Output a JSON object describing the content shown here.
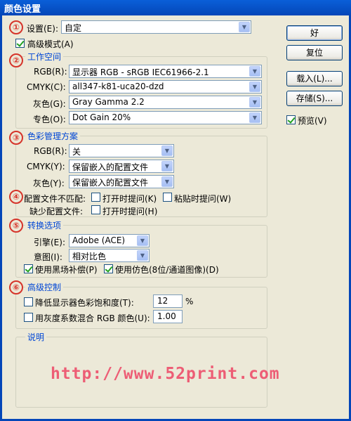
{
  "window": {
    "title": "颜色设置"
  },
  "markers": [
    "①",
    "②",
    "③",
    "④",
    "⑤",
    "⑥"
  ],
  "settings": {
    "label": "设置(E):",
    "value": "自定"
  },
  "advanced_mode": {
    "label": "高级模式(A)",
    "checked": true
  },
  "working_spaces": {
    "title": "工作空间",
    "rows": [
      {
        "label": "RGB(R):",
        "value": "显示器 RGB - sRGB IEC61966-2.1"
      },
      {
        "label": "CMYK(C):",
        "value": "all347-k81-uca20-dzd"
      },
      {
        "label": "灰色(G):",
        "value": "Gray Gamma 2.2"
      },
      {
        "label": "专色(O):",
        "value": "Dot Gain 20%"
      }
    ]
  },
  "color_management": {
    "title": "色彩管理方案",
    "rows": [
      {
        "label": "RGB(R):",
        "value": "关"
      },
      {
        "label": "CMYK(Y):",
        "value": "保留嵌入的配置文件"
      },
      {
        "label": "灰色(Y):",
        "value": "保留嵌入的配置文件"
      }
    ],
    "mismatch_label": "配置文件不匹配:",
    "ask_open_label": "打开时提问(K)",
    "ask_paste_label": "粘贴时提问(W)",
    "missing_label": "缺少配置文件:",
    "missing_ask_open_label": "打开时提问(H)"
  },
  "conversion": {
    "title": "转换选项",
    "engine_label": "引擎(E):",
    "engine_value": "Adobe (ACE)",
    "intent_label": "意图(I):",
    "intent_value": "相对比色",
    "black_point_label": "使用黑场补偿(P)",
    "dither_label": "使用仿色(8位/通道图像)(D)"
  },
  "advanced_controls": {
    "title": "高级控制",
    "desaturate_label": "降低显示器色彩饱和度(T):",
    "desaturate_value": "12",
    "desaturate_unit": "%",
    "blend_label": "用灰度系数混合 RGB 颜色(U):",
    "blend_value": "1.00"
  },
  "description": {
    "title": "说明"
  },
  "buttons": {
    "ok": "好",
    "reset": "复位",
    "load": "载入(L)...",
    "save": "存储(S)..."
  },
  "preview": {
    "label": "预览(V)",
    "checked": true
  },
  "watermark": "http://www.52print.com"
}
